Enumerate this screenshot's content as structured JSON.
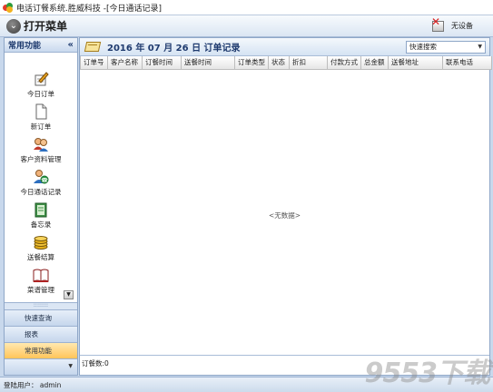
{
  "window": {
    "title": "电话订餐系统.胜威科技 -[今日通话记录]"
  },
  "toolbar": {
    "open_menu": "打开菜单",
    "device_status": "无设备"
  },
  "sidebar": {
    "header": "常用功能",
    "collapse_glyph": "«",
    "items": [
      {
        "label": "今日订单",
        "icon": "pen-paper-icon"
      },
      {
        "label": "新订单",
        "icon": "blank-page-icon"
      },
      {
        "label": "客户资料管理",
        "icon": "customers-icon"
      },
      {
        "label": "今日通话记录",
        "icon": "call-log-icon"
      },
      {
        "label": "备忘录",
        "icon": "memo-icon"
      },
      {
        "label": "送餐结算",
        "icon": "coins-icon"
      },
      {
        "label": "菜谱管理",
        "icon": "recipe-book-icon"
      }
    ],
    "grip": "::::::::",
    "sections": [
      {
        "label": "快速查询",
        "active": false
      },
      {
        "label": "报表",
        "active": false
      },
      {
        "label": "常用功能",
        "active": true
      }
    ]
  },
  "main": {
    "title": "2016 年 07 月 26 日 订单记录",
    "quick_search": "快速搜索",
    "columns": [
      "订单号",
      "客户名称",
      "订餐时间",
      "送餐时间",
      "订单类型",
      "状态",
      "折扣",
      "付款方式",
      "总金额",
      "送餐地址",
      "联系电话"
    ],
    "empty_text": "<无数据>",
    "footer": "订餐数:0"
  },
  "statusbar": {
    "text": "登陆用户： admin"
  },
  "watermark": "9553下载",
  "colors": {
    "accent": "#1e3a6e",
    "active_section": "#ffc55a",
    "panel_bg": "#dbe6f4"
  }
}
